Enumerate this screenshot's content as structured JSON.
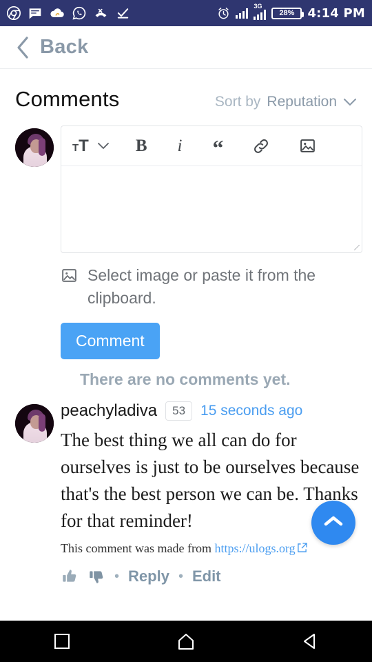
{
  "status_bar": {
    "time": "4:14 PM",
    "battery_percent": "28%",
    "network_label": "3G",
    "left_icons": [
      "chrome-icon",
      "message-icon",
      "cloud-upload-icon",
      "whatsapp-icon",
      "missed-call-icon",
      "checkmark-icon"
    ],
    "right_icons": [
      "alarm-icon",
      "signal-bars-icon",
      "signal-bars-3g-icon",
      "battery-icon"
    ],
    "background_color": "#2f3670"
  },
  "nav": {
    "back_label": "Back"
  },
  "header": {
    "title": "Comments",
    "sort_by_label": "Sort by",
    "sort_value": "Reputation"
  },
  "editor": {
    "toolbar": {
      "text_size_small": "T",
      "text_size_big": "T",
      "bold": "B",
      "italic": "i",
      "quote": "“",
      "link_icon": "link-icon",
      "image_icon": "image-icon",
      "caret_icon": "chevron-down-icon"
    },
    "textarea_value": "",
    "textarea_placeholder": "",
    "image_hint": "Select image or paste it from the clipboard.",
    "submit_label": "Comment",
    "empty_state": "There are no comments yet."
  },
  "comment": {
    "username": "peachyladiva",
    "reputation": "53",
    "timestamp": "15 seconds ago",
    "body": "The best thing we all can do for ourselves is just to be ourselves because that's the best person we can be. Thanks for that reminder!",
    "source_prefix": "This comment was made from",
    "source_link": "https://ulogs.org",
    "actions": {
      "upvote_icon": "thumbs-up-icon",
      "downvote_icon": "thumbs-down-icon",
      "separator": "•",
      "reply": "Reply",
      "edit": "Edit"
    }
  },
  "fab": {
    "icon": "chevron-up-icon"
  },
  "system_nav": {
    "recents_icon": "square-recents-icon",
    "home_icon": "home-icon",
    "back_icon": "triangle-back-icon"
  },
  "colors": {
    "status_bar": "#2f3670",
    "accent_blue": "#4aa3f5",
    "link_blue": "#4a9df0",
    "muted": "#8a99a8"
  }
}
